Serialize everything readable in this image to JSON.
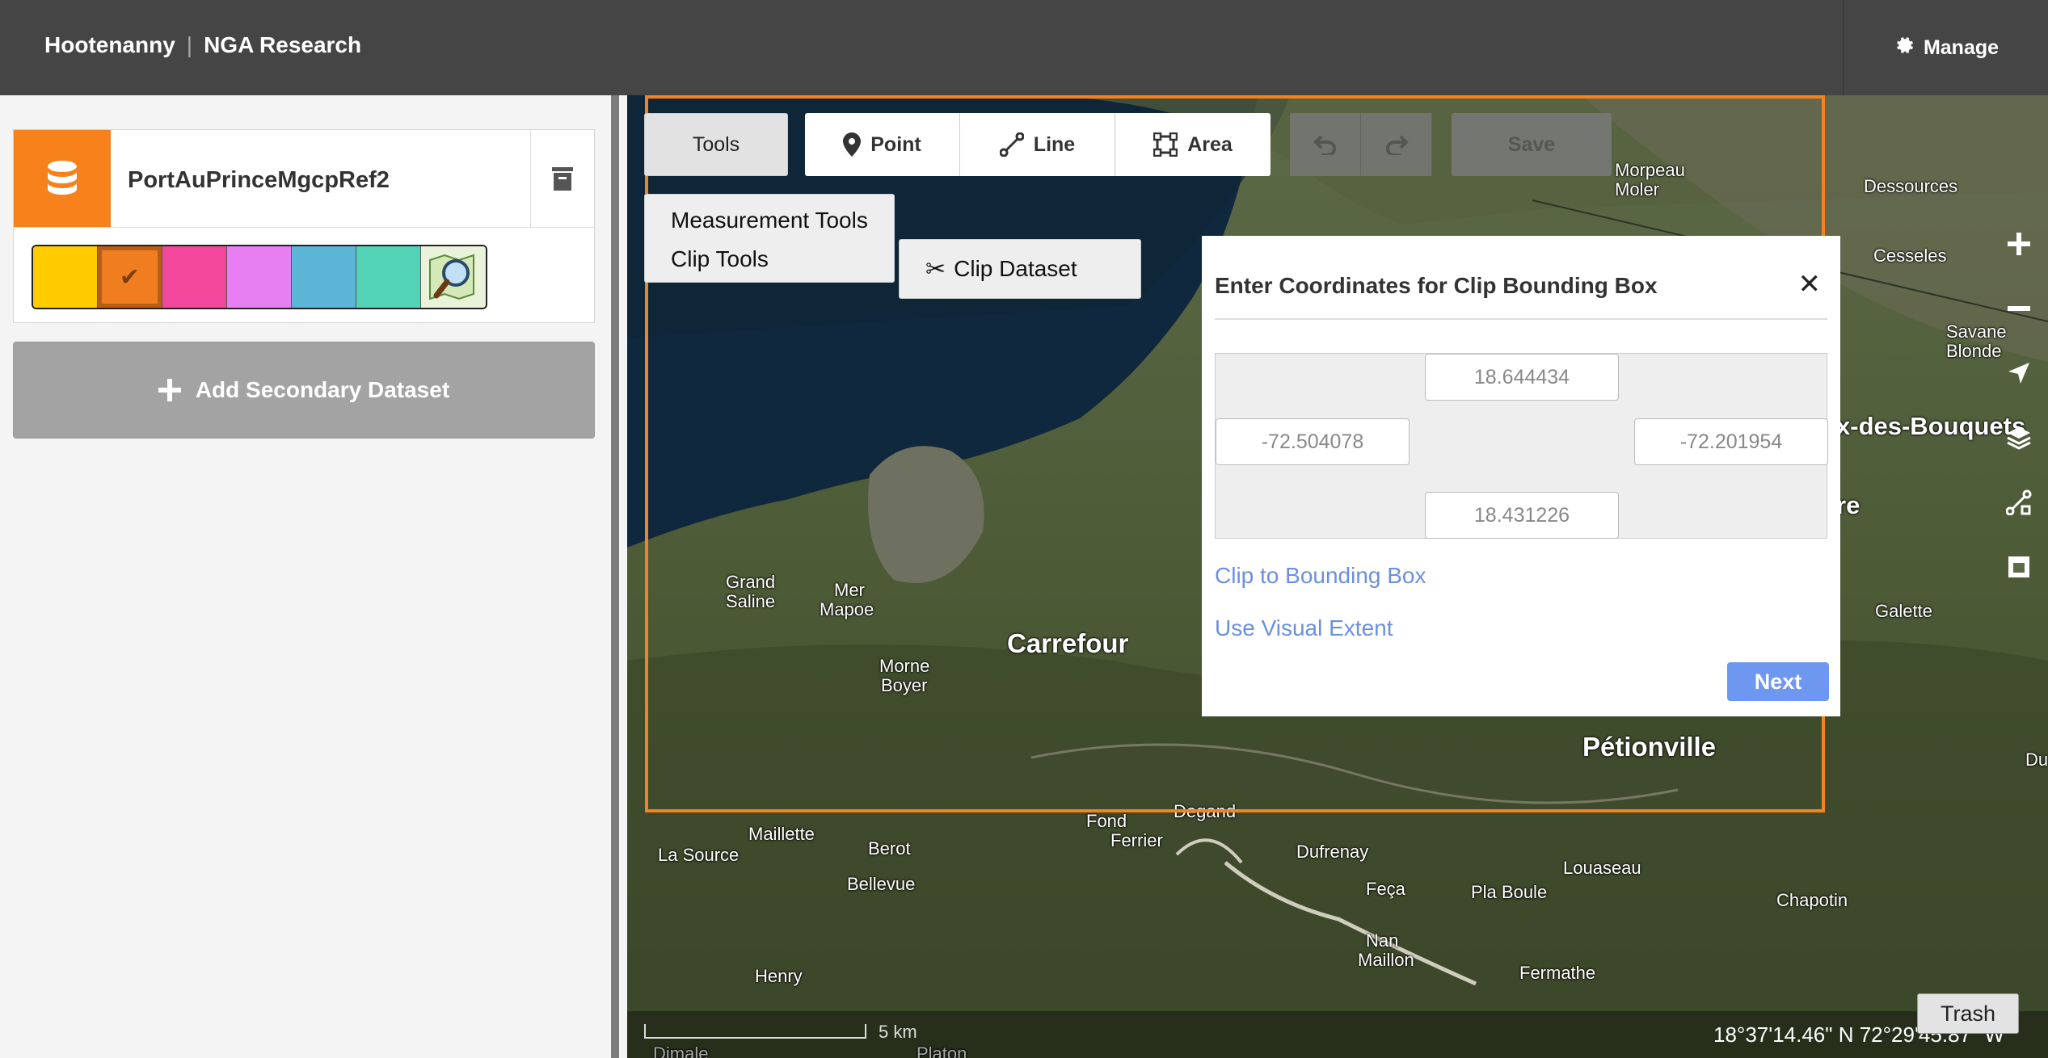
{
  "header": {
    "app_name": "Hootenanny",
    "project_name": "NGA Research",
    "manage_label": "Manage"
  },
  "sidebar": {
    "dataset_name": "PortAuPrinceMgcpRef2",
    "swatch_colors": [
      "#ffcc00",
      "#f07d1f",
      "#f2479a",
      "#e77ff2",
      "#5bb5d6",
      "#53d4b6"
    ],
    "selected_swatch": 1,
    "add_secondary_label": "Add Secondary Dataset"
  },
  "toolbar": {
    "tools_label": "Tools",
    "point_label": "Point",
    "line_label": "Line",
    "area_label": "Area",
    "save_label": "Save"
  },
  "tools_menu": {
    "items": [
      "Measurement Tools",
      "Clip Tools"
    ],
    "submenu_item": "Clip Dataset"
  },
  "clip_modal": {
    "title": "Enter Coordinates for Clip Bounding Box",
    "north": "18.644434",
    "west": "-72.504078",
    "east": "-72.201954",
    "south": "18.431226",
    "link_clip": "Clip to Bounding Box",
    "link_visual": "Use Visual Extent",
    "next_label": "Next"
  },
  "map": {
    "places": [
      "Morpeau",
      "Moler",
      "Dessources",
      "Cesseles",
      "Savane",
      "Blonde",
      "x-des-Bouquets",
      "re",
      "Galette",
      "Grand",
      "Saline",
      "Mer",
      "Mapoe",
      "Carrefour",
      "Morne",
      "Boyer",
      "Pétionville",
      "Maillette",
      "Berot",
      "La Source",
      "Bellevue",
      "Fond",
      "Ferrier",
      "Degand",
      "Dufrenay",
      "Feça",
      "Pla Boule",
      "Louaseau",
      "Chapotin",
      "Nan",
      "Maillon",
      "Henry",
      "Fermathe",
      "Du",
      "Dimale",
      "Platon"
    ],
    "scale_label": "5 km",
    "coordinates": "18°37'14.46\" N 72°29'45.87\" W",
    "trash_tooltip": "Trash"
  }
}
